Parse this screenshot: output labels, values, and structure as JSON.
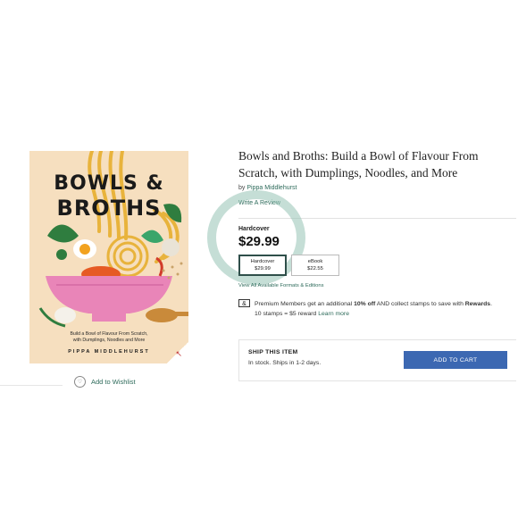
{
  "cover": {
    "title_line1": "BOWLS &",
    "title_line2": "BROTHS",
    "subtitle_line1": "Build a Bowl of Flavour From Scratch,",
    "subtitle_line2": "with Dumplings, Noodles and More",
    "author": "PIPPA MIDDLEHURST"
  },
  "wishlist": {
    "label": "Add to Wishlist",
    "icon": "heart-icon"
  },
  "product": {
    "title": "Bowls and Broths: Build a Bowl of Flavour From Scratch, with Dumplings, Noodles, and More",
    "by_prefix": "by",
    "author": "Pippa Middlehurst",
    "write_review": "Write A Review",
    "selected_format": "Hardcover",
    "price": "$29.99",
    "formats": [
      {
        "name": "Hardcover",
        "price": "$29.99"
      },
      {
        "name": "eBook",
        "price": "$22.55"
      }
    ],
    "view_all_formats": "View All Available Formats & Editions"
  },
  "promo": {
    "icon_glyph": "&",
    "text_before": "Premium Members get an additional",
    "highlight": "10% off",
    "text_middle": "AND collect stamps to save with",
    "rewards": "Rewards",
    "text_line2": "10 stamps = $5 reward",
    "learn_more": "Learn more"
  },
  "shipping": {
    "title": "SHIP THIS ITEM",
    "stock": "In stock. Ships in 1-2 days.",
    "button": "ADD TO CART"
  },
  "colors": {
    "accent_green": "#2e6b5b",
    "cart_blue": "#3c68b2",
    "cover_bg": "#f6dfbf",
    "highlight_circle": "#96c3b4"
  }
}
